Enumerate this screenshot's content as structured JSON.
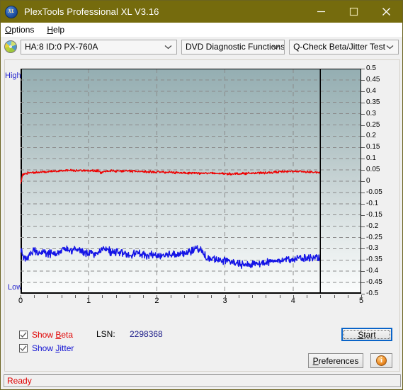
{
  "window": {
    "title": "PlexTools Professional XL V3.16",
    "app_icon": "xl-disc-icon",
    "minimize_label": "—",
    "maximize_label": "□",
    "close_label": "✕"
  },
  "menubar": {
    "items": [
      {
        "label": "Options",
        "accel": "O"
      },
      {
        "label": "Help",
        "accel": "H"
      }
    ]
  },
  "toolbar": {
    "drive_icon": "cd-disc-icon",
    "drive_select": {
      "value": "HA:8 ID:0  PX-760A",
      "options": [
        "HA:8 ID:0  PX-760A"
      ]
    },
    "function_select": {
      "value": "DVD Diagnostic Functions",
      "options": [
        "DVD Diagnostic Functions"
      ]
    },
    "test_select": {
      "value": "Q-Check Beta/Jitter Test",
      "options": [
        "Q-Check Beta/Jitter Test"
      ]
    }
  },
  "chart_labels": {
    "high": "High",
    "low": "Low"
  },
  "controls": {
    "show_beta": {
      "label": "Show Beta",
      "accel": "B",
      "checked": true,
      "color": "#e00000"
    },
    "show_jitter": {
      "label": "Show Jitter",
      "accel": "J",
      "checked": true,
      "color": "#1414d2"
    },
    "lsn_label": "LSN:",
    "lsn_value": "2298368",
    "start_button": {
      "label": "Start",
      "accel": "S"
    },
    "preferences_button": {
      "label": "Preferences",
      "accel": "P"
    },
    "info_button": {
      "label": "i"
    }
  },
  "statusbar": {
    "text": "Ready"
  },
  "chart_data": {
    "type": "line",
    "title": "Q-Check Beta/Jitter Test",
    "xlabel": "",
    "ylabel": "",
    "xlim": [
      0,
      5
    ],
    "ylim": [
      -0.5,
      0.5
    ],
    "xticks": [
      0,
      1,
      2,
      3,
      4,
      5
    ],
    "yticks": [
      0.5,
      0.45,
      0.4,
      0.35,
      0.3,
      0.25,
      0.2,
      0.15,
      0.1,
      0.05,
      0,
      -0.05,
      -0.1,
      -0.15,
      -0.2,
      -0.25,
      -0.3,
      -0.35,
      -0.4,
      -0.45,
      -0.5
    ],
    "ytick_labels": [
      "0.5",
      "0.45",
      "0.4",
      "0.35",
      "0.3",
      "0.25",
      "0.2",
      "0.15",
      "0.1",
      "0.05",
      "0",
      "-0.05",
      "-0.1",
      "-0.15",
      "-0.2",
      "-0.25",
      "-0.3",
      "-0.35",
      "-0.4",
      "-0.45",
      "-0.5"
    ],
    "grid": true,
    "grid_style": "dashed",
    "grid_color": "#8a8a8a",
    "background_gradient": [
      "#94aeb2",
      "#fbfcfc"
    ],
    "data_end_marker_x": 4.4,
    "legend_position": "below-left",
    "series": [
      {
        "name": "Beta",
        "color": "#ee0000",
        "x": [
          0.0,
          0.03,
          0.06,
          0.1,
          0.15,
          0.2,
          0.26,
          0.32,
          0.38,
          0.45,
          0.52,
          0.6,
          0.68,
          0.76,
          0.84,
          0.92,
          1.0,
          1.08,
          1.16,
          1.18,
          1.24,
          1.32,
          1.4,
          1.48,
          1.56,
          1.64,
          1.72,
          1.8,
          1.88,
          1.96,
          2.04,
          2.12,
          2.2,
          2.28,
          2.36,
          2.44,
          2.52,
          2.6,
          2.68,
          2.76,
          2.84,
          2.92,
          3.0,
          3.08,
          3.16,
          3.24,
          3.32,
          3.4,
          3.48,
          3.56,
          3.64,
          3.72,
          3.8,
          3.88,
          3.96,
          4.04,
          4.12,
          4.2,
          4.28,
          4.36,
          4.4
        ],
        "y": [
          -0.015,
          0.03,
          0.034,
          0.036,
          0.038,
          0.039,
          0.04,
          0.041,
          0.042,
          0.045,
          0.046,
          0.047,
          0.048,
          0.048,
          0.047,
          0.047,
          0.046,
          0.046,
          0.047,
          0.034,
          0.046,
          0.046,
          0.045,
          0.045,
          0.045,
          0.044,
          0.044,
          0.043,
          0.042,
          0.041,
          0.041,
          0.04,
          0.039,
          0.038,
          0.038,
          0.037,
          0.037,
          0.036,
          0.036,
          0.035,
          0.035,
          0.034,
          0.033,
          0.033,
          0.033,
          0.034,
          0.035,
          0.036,
          0.036,
          0.037,
          0.038,
          0.04,
          0.042,
          0.043,
          0.044,
          0.044,
          0.043,
          0.042,
          0.041,
          0.038,
          0.036
        ]
      },
      {
        "name": "Jitter",
        "color": "#1414e6",
        "x": [
          0.0,
          0.05,
          0.1,
          0.15,
          0.2,
          0.25,
          0.3,
          0.35,
          0.4,
          0.45,
          0.5,
          0.55,
          0.6,
          0.65,
          0.7,
          0.75,
          0.8,
          0.85,
          0.9,
          0.95,
          1.0,
          1.05,
          1.1,
          1.15,
          1.2,
          1.25,
          1.3,
          1.35,
          1.4,
          1.45,
          1.5,
          1.55,
          1.6,
          1.65,
          1.7,
          1.75,
          1.8,
          1.85,
          1.9,
          1.95,
          2.0,
          2.05,
          2.1,
          2.15,
          2.2,
          2.25,
          2.3,
          2.35,
          2.4,
          2.45,
          2.5,
          2.55,
          2.6,
          2.65,
          2.7,
          2.75,
          2.8,
          2.85,
          2.9,
          2.95,
          3.0,
          3.05,
          3.1,
          3.15,
          3.2,
          3.25,
          3.3,
          3.35,
          3.4,
          3.45,
          3.5,
          3.55,
          3.6,
          3.65,
          3.7,
          3.75,
          3.8,
          3.85,
          3.9,
          3.95,
          4.0,
          4.05,
          4.1,
          4.15,
          4.2,
          4.25,
          4.3,
          4.35,
          4.4
        ],
        "y": [
          -0.295,
          -0.345,
          -0.345,
          -0.32,
          -0.31,
          -0.315,
          -0.32,
          -0.315,
          -0.318,
          -0.322,
          -0.325,
          -0.318,
          -0.31,
          -0.3,
          -0.305,
          -0.315,
          -0.3,
          -0.305,
          -0.31,
          -0.318,
          -0.315,
          -0.318,
          -0.322,
          -0.318,
          -0.305,
          -0.3,
          -0.31,
          -0.315,
          -0.312,
          -0.318,
          -0.322,
          -0.325,
          -0.328,
          -0.322,
          -0.318,
          -0.322,
          -0.328,
          -0.33,
          -0.328,
          -0.325,
          -0.33,
          -0.332,
          -0.33,
          -0.328,
          -0.325,
          -0.322,
          -0.32,
          -0.322,
          -0.325,
          -0.318,
          -0.31,
          -0.305,
          -0.3,
          -0.305,
          -0.33,
          -0.345,
          -0.348,
          -0.345,
          -0.348,
          -0.35,
          -0.352,
          -0.355,
          -0.36,
          -0.365,
          -0.368,
          -0.37,
          -0.372,
          -0.37,
          -0.368,
          -0.366,
          -0.365,
          -0.363,
          -0.36,
          -0.358,
          -0.356,
          -0.353,
          -0.35,
          -0.348,
          -0.346,
          -0.345,
          -0.344,
          -0.343,
          -0.343,
          -0.342,
          -0.342,
          -0.341,
          -0.341,
          -0.34,
          -0.34
        ],
        "noise_band": 0.02
      }
    ]
  }
}
